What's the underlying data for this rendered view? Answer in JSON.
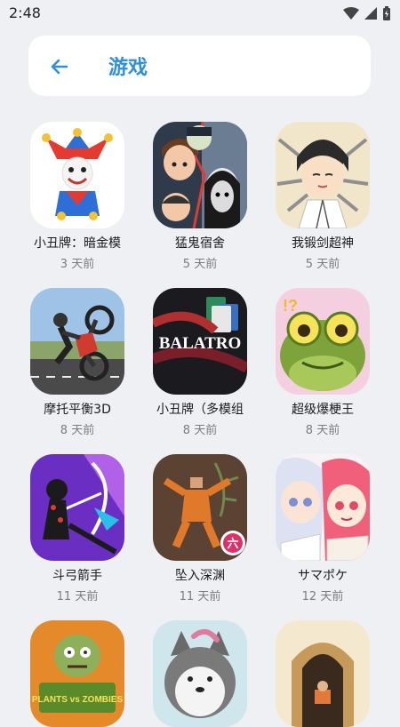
{
  "status_bar": {
    "time": "2:48"
  },
  "header": {
    "title": "游戏"
  },
  "apps": [
    {
      "name": "小丑牌：暗金模",
      "time": "3 天前"
    },
    {
      "name": "猛鬼宿舍",
      "time": "5 天前"
    },
    {
      "name": "我锻剑超神",
      "time": "5 天前"
    },
    {
      "name": "摩托平衡3D",
      "time": "8 天前"
    },
    {
      "name": "小丑牌（多模组",
      "time": "8 天前"
    },
    {
      "name": "超级爆梗王",
      "time": "8 天前"
    },
    {
      "name": "斗弓箭手",
      "time": "11 天前"
    },
    {
      "name": "坠入深渊",
      "time": "11 天前"
    },
    {
      "name": "サマポケ",
      "time": "12 天前"
    }
  ],
  "icons": {
    "balatro_text": "BALATRO",
    "pvz_text": "PLANTS vs ZOMBIES",
    "fall_badge": "六",
    "frog_badge": "!?"
  }
}
